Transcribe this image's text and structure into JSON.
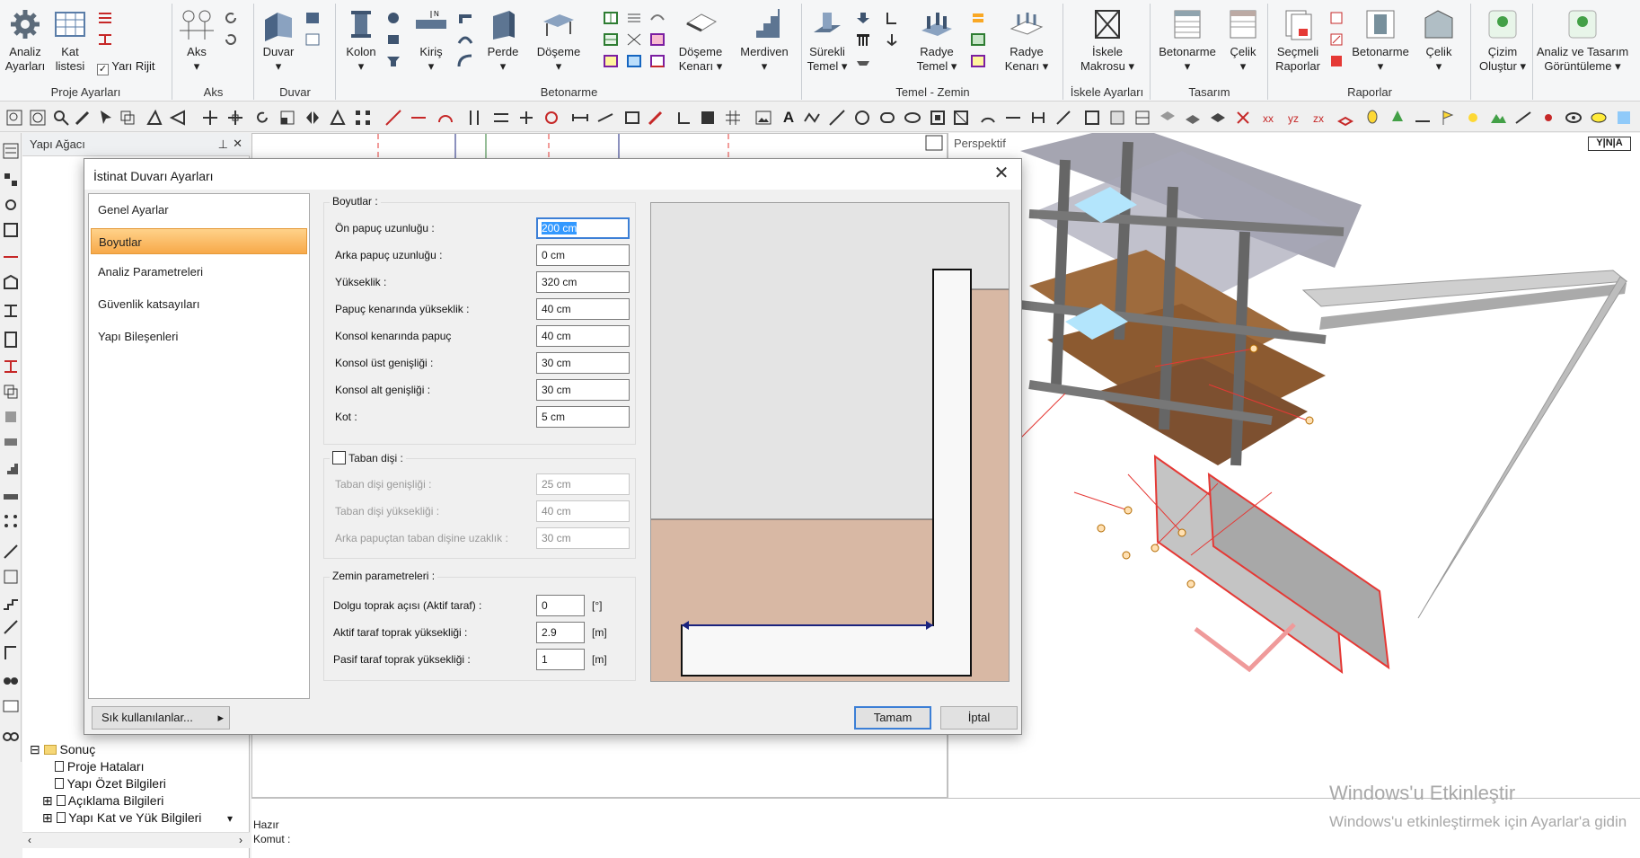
{
  "ribbon": {
    "groups": [
      {
        "label": "Proje Ayarları"
      },
      {
        "label": "Aks"
      },
      {
        "label": "Duvar"
      },
      {
        "label": "Betonarme"
      },
      {
        "label": "Temel - Zemin"
      },
      {
        "label": "İskele Ayarları"
      },
      {
        "label": "Tasarım"
      },
      {
        "label": "Raporlar"
      }
    ],
    "buttons": {
      "analiz_ayarlari": "Analiz Ayarları",
      "kat_listesi": "Kat listesi",
      "yari_rijit": "Yarı Rijit",
      "aks": "Aks",
      "duvar": "Duvar",
      "kolon": "Kolon",
      "kiris": "Kiriş",
      "perde": "Perde",
      "doseme": "Döşeme",
      "doseme_kenari": "Döşeme Kenarı",
      "merdiven": "Merdiven",
      "surekli_temel": "Sürekli Temel",
      "radye_temel": "Radye Temel",
      "radye_kenari": "Radye Kenarı",
      "iskele_makrosu": "İskele Makrosu",
      "betonarme_tasarim": "Betonarme",
      "celik_tasarim": "Çelik",
      "secmeli_raporlar": "Seçmeli Raporlar",
      "betonarme_rapor": "Betonarme",
      "celik_rapor": "Çelik",
      "cizim_olustur": "Çizim Oluştur",
      "analiz_tasarim_goruntuleme": "Analiz ve Tasarım Görüntüleme"
    }
  },
  "tree": {
    "title": "Yapı Ağacı",
    "items": [
      "Sonuç",
      "Proje Hataları",
      "Yapı Özet Bilgileri",
      "Açıklama Bilgileri",
      "Yapı Kat ve Yük Bilgileri"
    ]
  },
  "view3d": {
    "label": "Perspektif"
  },
  "status": {
    "ready": "Hazır",
    "command": "Komut :"
  },
  "dialog": {
    "title": "İstinat Duvarı Ayarları",
    "nav": [
      "Genel Ayarlar",
      "Boyutlar",
      "Analiz Parametreleri",
      "Güvenlik katsayıları",
      "Yapı Bileşenleri"
    ],
    "selected_nav": "Boyutlar",
    "favorites_button": "Sık kullanılanlar...",
    "ok_button": "Tamam",
    "cancel_button": "İptal",
    "boyutlar": {
      "legend": "Boyutlar :",
      "fields": [
        {
          "label": "Ön papuç uzunluğu :",
          "value": "200 cm"
        },
        {
          "label": "Arka papuç uzunluğu :",
          "value": "0 cm"
        },
        {
          "label": "Yükseklik :",
          "value": "320 cm"
        },
        {
          "label": "Papuç kenarında yükseklik :",
          "value": "40 cm"
        },
        {
          "label": "Konsol kenarında papuç",
          "value": "40 cm"
        },
        {
          "label": "Konsol üst genişliği :",
          "value": "30 cm"
        },
        {
          "label": "Konsol alt genişliği :",
          "value": "30 cm"
        },
        {
          "label": "Kot :",
          "value": "5 cm"
        }
      ]
    },
    "taban_disi": {
      "legend": "Taban dişi :",
      "checked": false,
      "fields": [
        {
          "label": "Taban dişi genişliği :",
          "value": "25 cm"
        },
        {
          "label": "Taban dişi yüksekliği :",
          "value": "40 cm"
        },
        {
          "label": "Arka papuçtan taban dişine uzaklık :",
          "value": "30 cm"
        }
      ]
    },
    "zemin": {
      "legend": "Zemin parametreleri :",
      "fields": [
        {
          "label": "Dolgu toprak açısı (Aktif taraf) :",
          "value": "0",
          "unit": "[°]"
        },
        {
          "label": "Aktif taraf toprak yüksekliği :",
          "value": "2.9",
          "unit": "[m]"
        },
        {
          "label": "Pasif taraf toprak yüksekliği :",
          "value": "1",
          "unit": "[m]"
        }
      ]
    }
  },
  "watermark": {
    "line1": "Windows'u Etkinleştir",
    "line2": "Windows'u etkinleştirmek için Ayarlar'a gidin"
  },
  "colors": {
    "selected_nav": "#f7a949",
    "soil": "#d4b4a0",
    "highlight": "#3399ff"
  }
}
